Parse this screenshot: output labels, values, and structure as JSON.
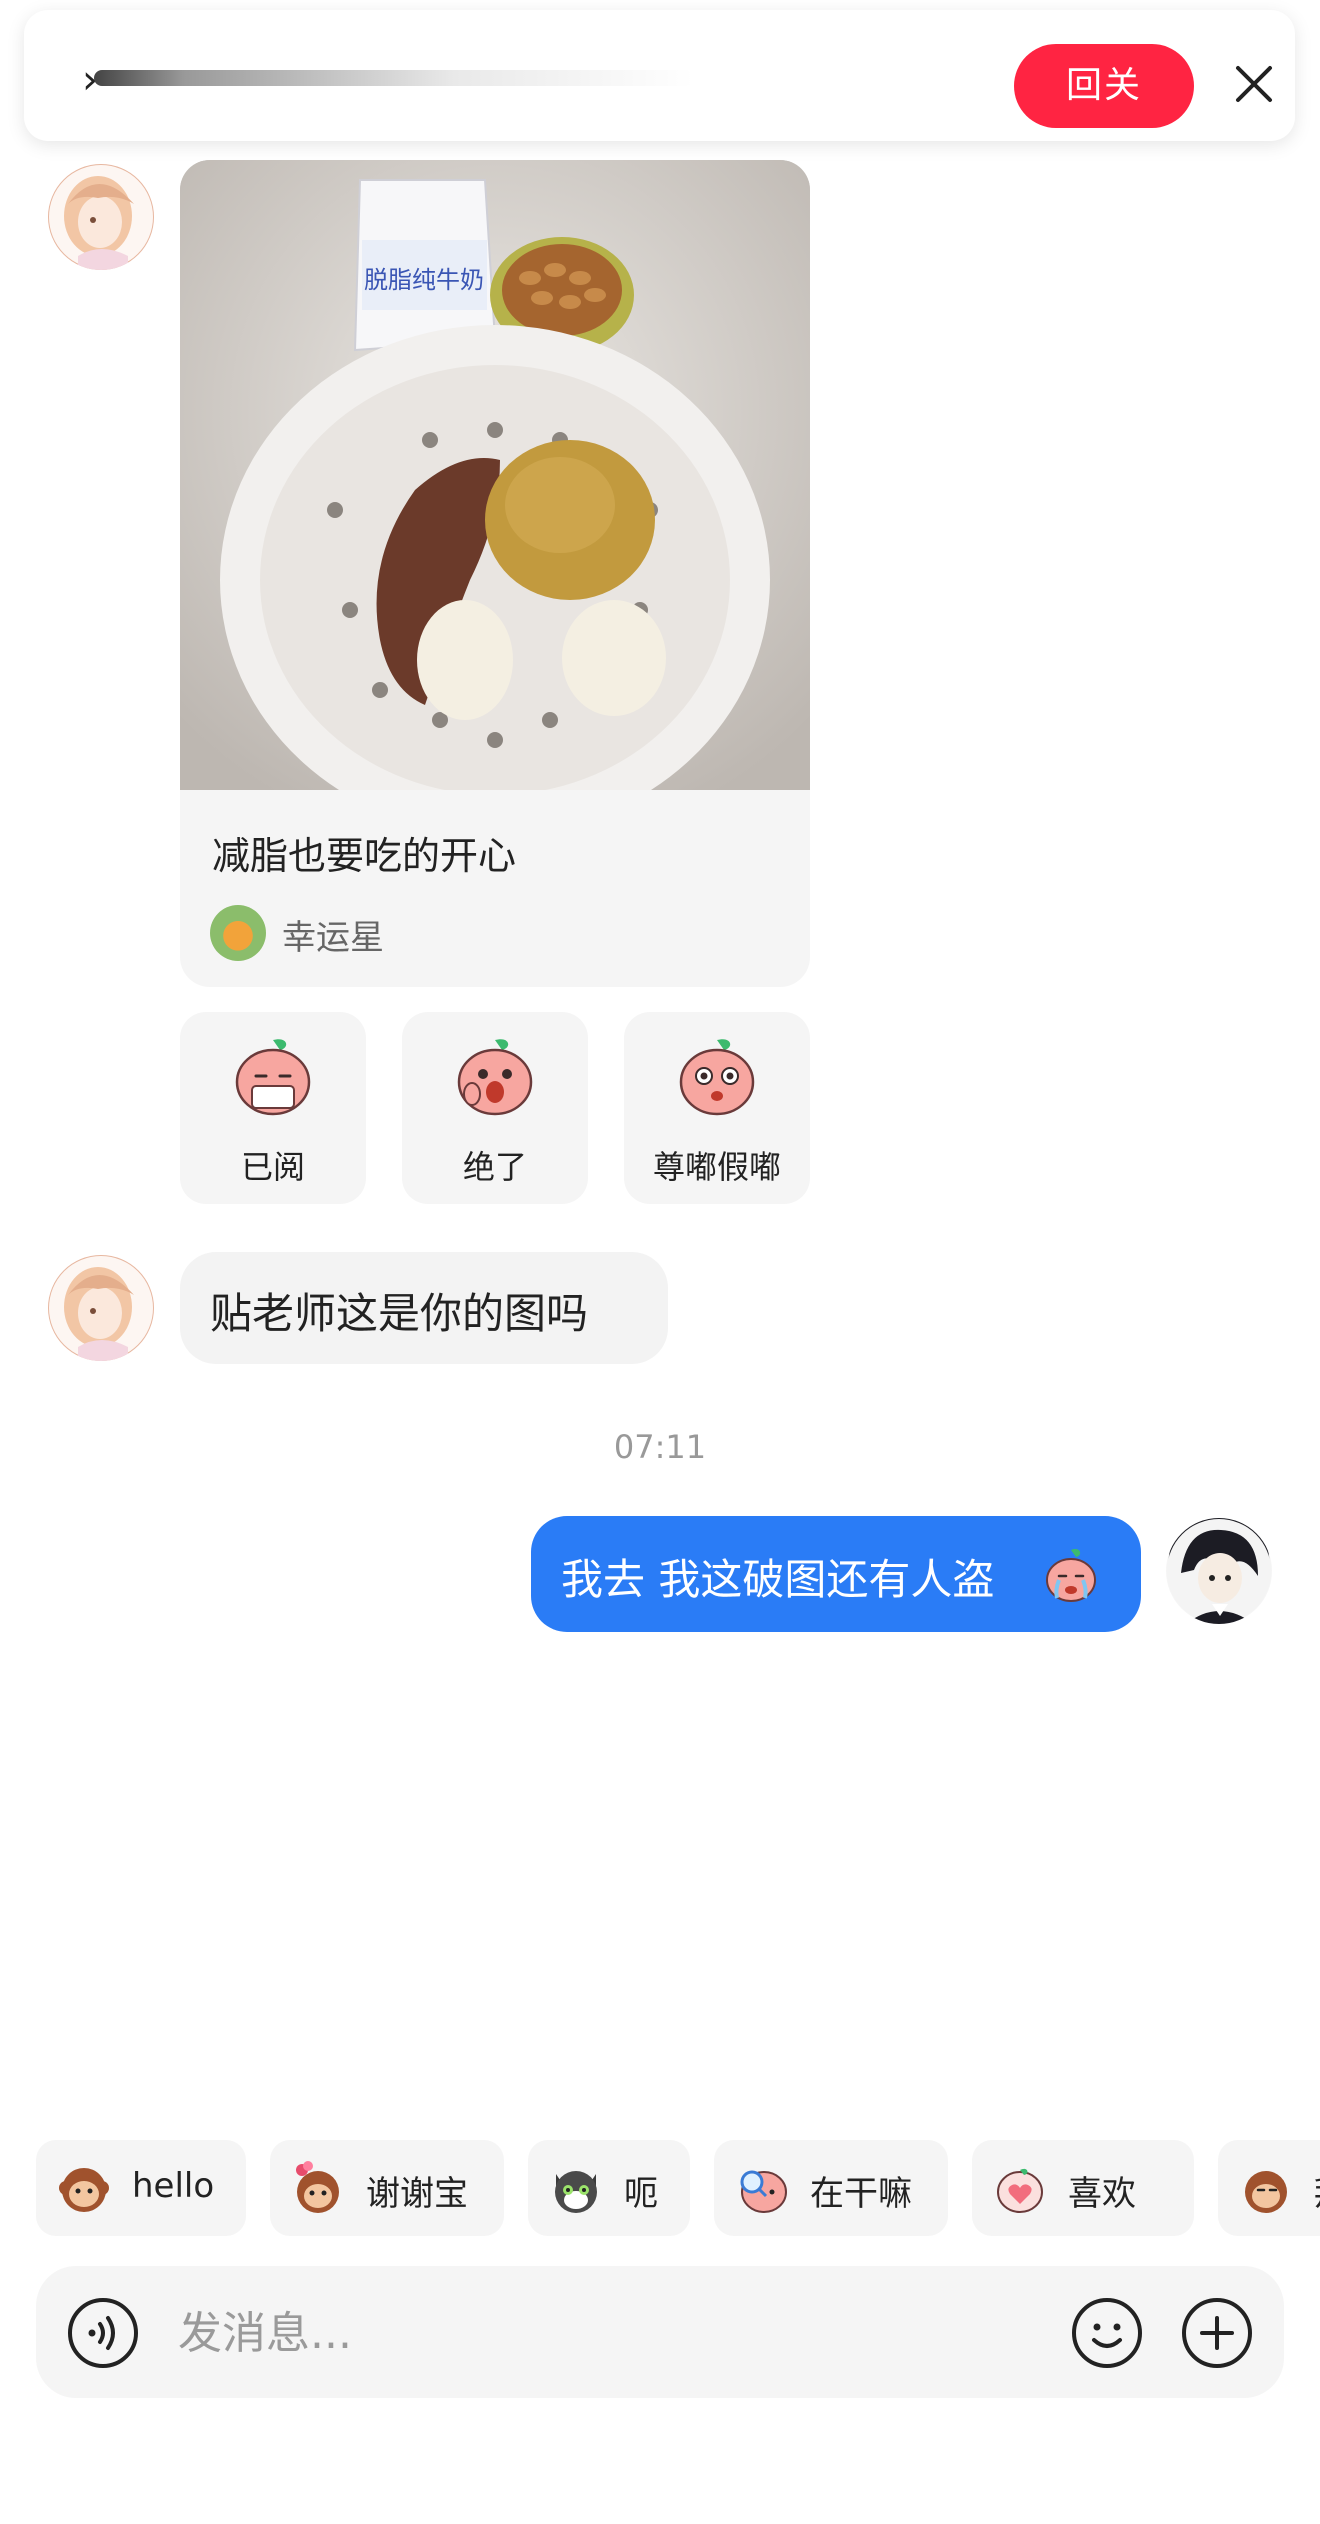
{
  "banner": {
    "follow_label": "回关"
  },
  "post_card": {
    "title": "减脂也要吃的开心",
    "author": "幸运星",
    "image_text": "脱脂纯牛奶"
  },
  "quick_replies": [
    {
      "label": "已阅",
      "icon": "peach-sticker-reading-icon"
    },
    {
      "label": "绝了",
      "icon": "peach-sticker-shocked-icon"
    },
    {
      "label": "尊嘟假嘟",
      "icon": "peach-sticker-surprised-icon"
    }
  ],
  "messages": [
    {
      "side": "left",
      "text": "贴老师这是你的图吗"
    },
    {
      "side": "right",
      "text": "我去 我这破图还有人盗"
    }
  ],
  "timestamp": "07:11",
  "sticker_chips": [
    {
      "label": "hello",
      "icon": "monkey-sticker-icon"
    },
    {
      "label": "谢谢宝",
      "icon": "monkey-flower-sticker-icon"
    },
    {
      "label": "呃",
      "icon": "cat-sticker-icon"
    },
    {
      "label": "在干嘛",
      "icon": "peach-magnifier-sticker-icon"
    },
    {
      "label": "喜欢",
      "icon": "peach-heart-sticker-icon"
    },
    {
      "label": "拜",
      "icon": "monkey-bye-sticker-icon"
    }
  ],
  "input": {
    "placeholder": "发消息..."
  },
  "colors": {
    "accent_red": "#ff2442",
    "bubble_blue": "#2a7cf6",
    "card_gray": "#f5f5f5"
  }
}
